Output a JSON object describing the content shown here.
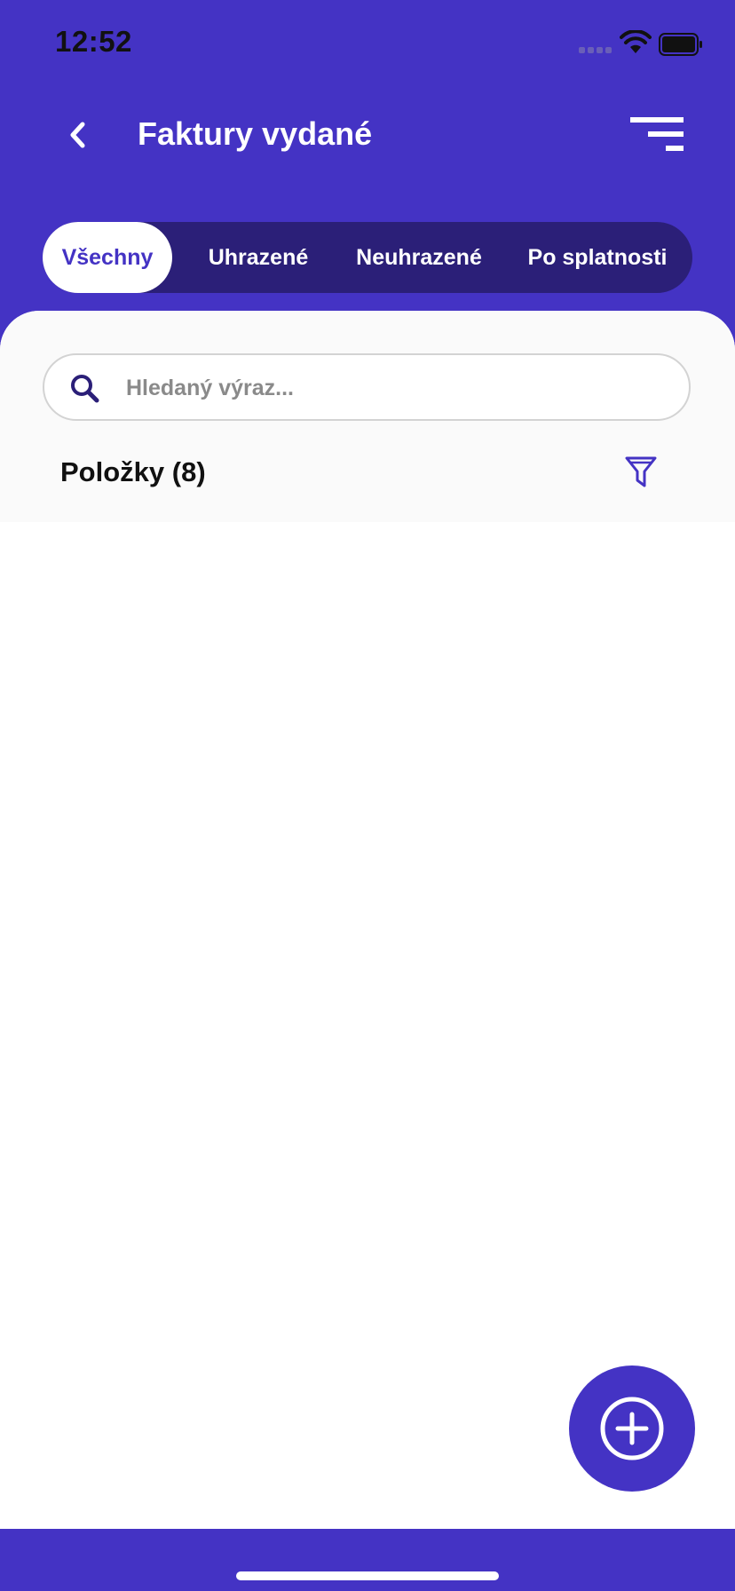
{
  "status_bar": {
    "time": "12:52"
  },
  "header": {
    "title": "Faktury vydané",
    "back_icon": "chevron-left-icon",
    "menu_icon": "sort-menu-icon"
  },
  "tabs": [
    {
      "label": "Všechny",
      "active": true
    },
    {
      "label": "Uhrazené",
      "active": false
    },
    {
      "label": "Neuhrazené",
      "active": false
    },
    {
      "label": "Po splatnosti",
      "active": false
    }
  ],
  "search": {
    "placeholder": "Hledaný výraz...",
    "value": ""
  },
  "list": {
    "heading": "Položky (8)"
  },
  "colors": {
    "primary": "#4433c4",
    "tab_background": "#2b1f78",
    "content_background": "#ffffff"
  },
  "fab": {
    "icon": "plus-circle-icon"
  }
}
